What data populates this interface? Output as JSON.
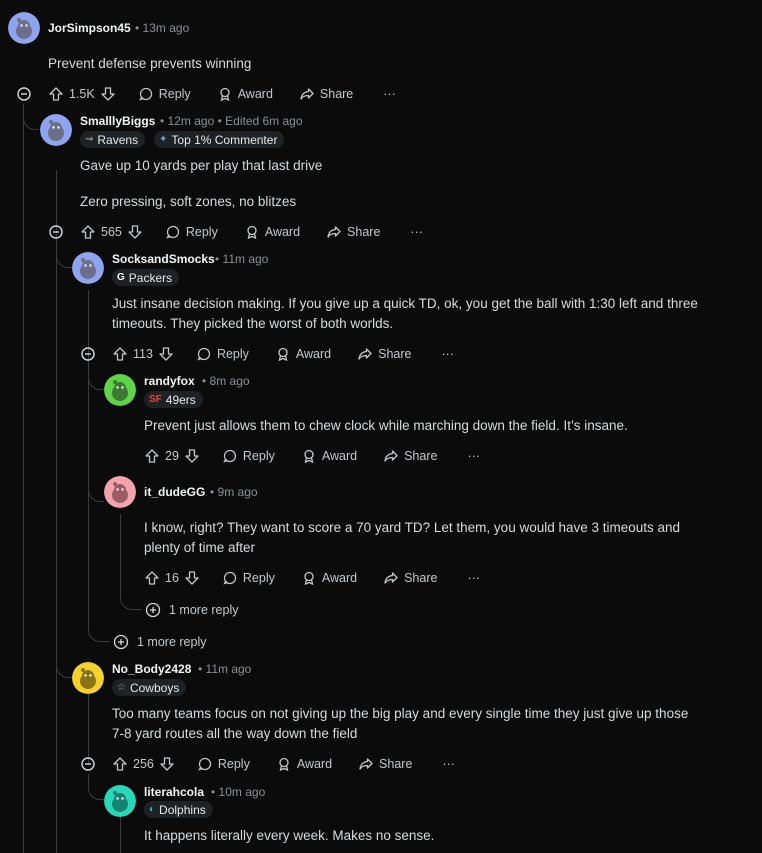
{
  "comments": [
    {
      "author": "JorSimpson45",
      "time": "13m ago",
      "edited": "",
      "flair": "",
      "body": [
        "Prevent defense prevents winning"
      ],
      "votes": "1.5K",
      "avatar_color": "#8fa4ee"
    },
    {
      "author": "SmalllyBiggs",
      "time": "12m ago",
      "edited": "Edited 6m ago",
      "flair": "Ravens",
      "flair2": "Top 1% Commenter",
      "body": [
        "Gave up 10 yards per play that last drive",
        "Zero pressing, soft zones, no blitzes"
      ],
      "votes": "565",
      "avatar_color": "#8fa4ee"
    },
    {
      "author": "SocksandSmocks",
      "time": "11m ago",
      "edited": "",
      "flair": "Packers",
      "body": [
        "Just insane decision making. If you give up a quick TD, ok, you get the ball with 1:30 left and three",
        "timeouts. They picked the worst of both worlds."
      ],
      "votes": "113",
      "avatar_color": "#8fa4ee"
    },
    {
      "author": "randyfox",
      "time": "8m ago",
      "edited": "",
      "flair": "49ers",
      "body": [
        "Prevent just allows them to chew clock while marching down the field. It’s insane."
      ],
      "votes": "29",
      "avatar_color": "#5fd34a"
    },
    {
      "author": "it_dudeGG",
      "time": "9m ago",
      "edited": "",
      "flair": "",
      "body": [
        "I know, right? They want to score a 70 yard TD? Let them, you would have 3 timeouts and",
        "plenty of time after"
      ],
      "votes": "16",
      "avatar_color": "#f4a3ad"
    },
    {
      "author": "No_Body2428",
      "time": "11m ago",
      "edited": "",
      "flair": "Cowboys",
      "body": [
        "Too many teams focus on not giving up the big play and every single time they just give up those",
        "7-8 yard routes all the way down the field"
      ],
      "votes": "256",
      "avatar_color": "#f6d12e"
    },
    {
      "author": "literahcola",
      "time": "10m ago",
      "edited": "",
      "flair": "Dolphins",
      "body": [
        "It happens literally every week. Makes no sense."
      ],
      "votes": "",
      "avatar_color": "#27d9b8"
    }
  ],
  "actions": {
    "reply": "Reply",
    "award": "Award",
    "share": "Share",
    "more": "···"
  },
  "more_replies": [
    "1 more reply",
    "1 more reply"
  ],
  "separator": "•"
}
